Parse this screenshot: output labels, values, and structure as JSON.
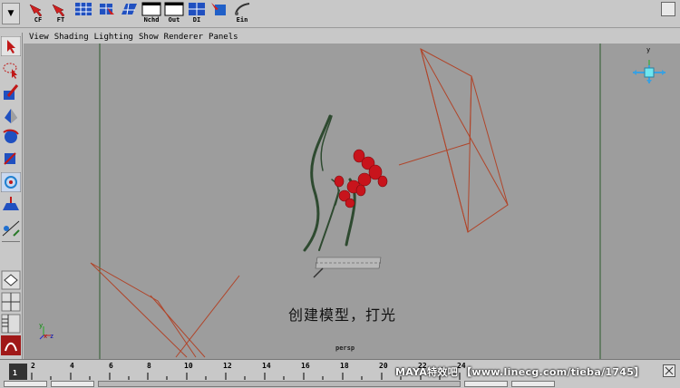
{
  "shelf": {
    "buttons": [
      {
        "label": "CF",
        "icon": "red-arrow-icon"
      },
      {
        "label": "FT",
        "icon": "red-arrow-icon"
      },
      {
        "label": "",
        "icon": "grid-panel-icon"
      },
      {
        "label": "",
        "icon": "select-grid-icon"
      },
      {
        "label": "",
        "icon": "uv-grid-icon"
      },
      {
        "label": "Nchd",
        "icon": "window-icon"
      },
      {
        "label": "Out",
        "icon": "window-icon"
      },
      {
        "label": "DI",
        "icon": "grid-panel-icon"
      },
      {
        "label": "",
        "icon": "shader-icon"
      },
      {
        "label": "Ein",
        "icon": "brush-icon"
      }
    ]
  },
  "panel_menu": [
    "View",
    "Shading",
    "Lighting",
    "Show",
    "Renderer",
    "Panels"
  ],
  "viewport": {
    "caption": "创建模型，打光",
    "camera_label": "persp",
    "axis": {
      "y": "y",
      "x": "x",
      "z": "z"
    }
  },
  "timeline": {
    "ticks": [
      "2",
      "4",
      "6",
      "8",
      "10",
      "12",
      "14",
      "16",
      "18",
      "20",
      "22",
      "24"
    ],
    "current_frame": "1",
    "watermark": "MAYA特效吧 【www.linecg.com/tieba/1745】"
  },
  "colors": {
    "viewport_bg": "#9d9d9d",
    "light_lines": "#b0452a",
    "berry": "#c8141c",
    "stem": "#2e4a30"
  }
}
